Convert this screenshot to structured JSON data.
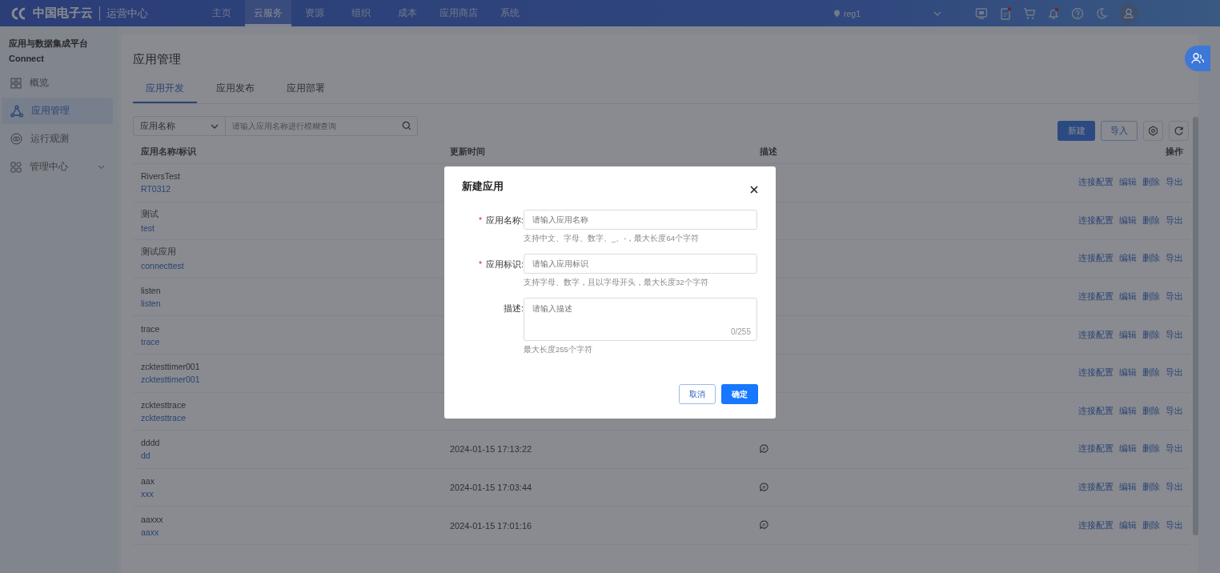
{
  "topbar": {
    "brand": "中国电子云",
    "subtitle": "运营中心",
    "nav": [
      {
        "label": "主页",
        "selected": false
      },
      {
        "label": "云服务",
        "selected": true
      },
      {
        "label": "资源",
        "selected": false
      },
      {
        "label": "组织",
        "selected": false
      },
      {
        "label": "成本",
        "selected": false
      },
      {
        "label": "应用商店",
        "selected": false
      },
      {
        "label": "系统",
        "selected": false
      }
    ],
    "region": "reg1"
  },
  "sidebar": {
    "title": "应用与数据集成平台",
    "subtitle": "Connect",
    "items": [
      {
        "label": "概览",
        "selected": false,
        "expandable": false
      },
      {
        "label": "应用管理",
        "selected": true,
        "expandable": false
      },
      {
        "label": "运行观测",
        "selected": false,
        "expandable": false
      },
      {
        "label": "管理中心",
        "selected": false,
        "expandable": true
      }
    ]
  },
  "page": {
    "title": "应用管理",
    "tabs": [
      {
        "label": "应用开发",
        "selected": true
      },
      {
        "label": "应用发布",
        "selected": false
      },
      {
        "label": "应用部署",
        "selected": false
      }
    ],
    "filter": {
      "select": "应用名称",
      "placeholder": "请输入应用名称进行模糊查询"
    },
    "buttons": {
      "primary": "新建",
      "secondary": "导入"
    }
  },
  "table": {
    "columns": [
      "应用名称/标识",
      "更新时间",
      "描述",
      "操作"
    ],
    "rows": [
      {
        "name": "RiversTest",
        "id": "RT0312",
        "actions": [
          "连接配置",
          "编辑",
          "删除",
          "导出"
        ]
      },
      {
        "name": "测试",
        "id": "test",
        "actions": [
          "连接配置",
          "编辑",
          "删除",
          "导出"
        ]
      },
      {
        "name": "测试应用",
        "id": "connecttest",
        "actions": [
          "连接配置",
          "编辑",
          "删除",
          "导出"
        ]
      },
      {
        "name": "listen",
        "id": "listen",
        "actions": [
          "连接配置",
          "编辑",
          "删除",
          "导出"
        ]
      },
      {
        "name": "trace",
        "id": "trace",
        "actions": [
          "连接配置",
          "编辑",
          "删除",
          "导出"
        ]
      },
      {
        "name": "zcktesttimer001",
        "id": "zcktesttimer001",
        "actions": [
          "连接配置",
          "编辑",
          "删除",
          "导出"
        ]
      },
      {
        "name": "zcktesttrace",
        "id": "zcktesttrace",
        "actions": [
          "连接配置",
          "编辑",
          "删除",
          "导出"
        ]
      },
      {
        "name": "dddd",
        "id": "dd",
        "time": "2024-01-15 17:13:22",
        "desc_icon": true,
        "actions": [
          "连接配置",
          "编辑",
          "删除",
          "导出"
        ]
      },
      {
        "name": "aax",
        "id": "xxx",
        "time": "2024-01-15 17:03:44",
        "desc_icon": true,
        "actions": [
          "连接配置",
          "编辑",
          "删除",
          "导出"
        ]
      },
      {
        "name": "aaxxx",
        "id": "aaxx",
        "time": "2024-01-15 17:01:16",
        "desc_icon": true,
        "actions": [
          "连接配置",
          "编辑",
          "删除",
          "导出"
        ]
      }
    ]
  },
  "dialog": {
    "title": "新建应用",
    "fields": [
      {
        "kind": "input",
        "mark": "*",
        "label": "应用名称:",
        "placeholder": "请输入应用名称",
        "hint": "支持中文、字母、数字、_、-，最大长度64个字符"
      },
      {
        "kind": "input",
        "mark": "*",
        "label": "应用标识:",
        "placeholder": "请输入应用标识",
        "hint": "支持字母、数字，且以字母开头，最大长度32个字符"
      },
      {
        "kind": "textarea",
        "label": "描述:",
        "placeholder": "请输入描述",
        "counter": "0/255",
        "hint": "最大长度255个字符"
      }
    ],
    "cancel": "取消",
    "ok": "确定"
  }
}
